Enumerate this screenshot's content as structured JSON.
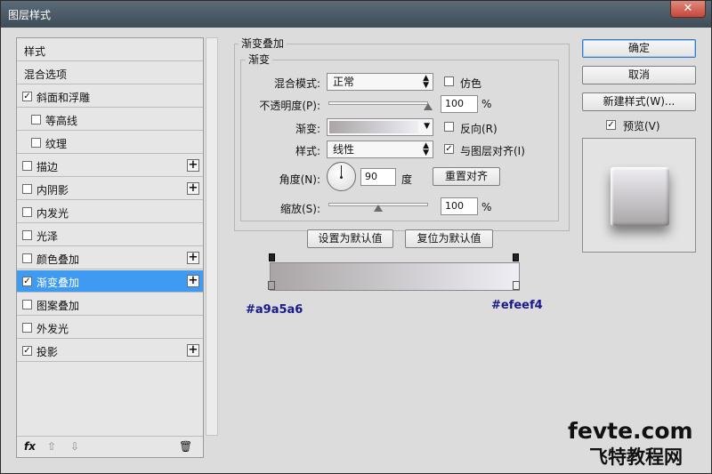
{
  "window": {
    "title": "图层样式",
    "close_label": "✕"
  },
  "left": {
    "items": [
      {
        "label": "样式",
        "checkbox": false,
        "checked": false,
        "plus": false,
        "indent": false,
        "selected": false
      },
      {
        "label": "混合选项",
        "checkbox": false,
        "checked": false,
        "plus": false,
        "indent": false,
        "selected": false
      },
      {
        "label": "斜面和浮雕",
        "checkbox": true,
        "checked": true,
        "plus": false,
        "indent": false,
        "selected": false
      },
      {
        "label": "等高线",
        "checkbox": true,
        "checked": false,
        "plus": false,
        "indent": true,
        "selected": false
      },
      {
        "label": "纹理",
        "checkbox": true,
        "checked": false,
        "plus": false,
        "indent": true,
        "selected": false
      },
      {
        "label": "描边",
        "checkbox": true,
        "checked": false,
        "plus": true,
        "indent": false,
        "selected": false
      },
      {
        "label": "内阴影",
        "checkbox": true,
        "checked": false,
        "plus": true,
        "indent": false,
        "selected": false
      },
      {
        "label": "内发光",
        "checkbox": true,
        "checked": false,
        "plus": false,
        "indent": false,
        "selected": false
      },
      {
        "label": "光泽",
        "checkbox": true,
        "checked": false,
        "plus": false,
        "indent": false,
        "selected": false
      },
      {
        "label": "颜色叠加",
        "checkbox": true,
        "checked": false,
        "plus": true,
        "indent": false,
        "selected": false
      },
      {
        "label": "渐变叠加",
        "checkbox": true,
        "checked": true,
        "plus": true,
        "indent": false,
        "selected": true
      },
      {
        "label": "图案叠加",
        "checkbox": true,
        "checked": false,
        "plus": false,
        "indent": false,
        "selected": false
      },
      {
        "label": "外发光",
        "checkbox": true,
        "checked": false,
        "plus": false,
        "indent": false,
        "selected": false
      },
      {
        "label": "投影",
        "checkbox": true,
        "checked": true,
        "plus": true,
        "indent": false,
        "selected": false
      }
    ],
    "footer": {
      "fx": "fx",
      "up": "⇧",
      "down": "⇩",
      "trash": "🗑"
    }
  },
  "main": {
    "group_title": "渐变叠加",
    "sub_title": "渐变",
    "blend_mode_label": "混合模式:",
    "blend_mode_value": "正常",
    "dither_label": "仿色",
    "opacity_label": "不透明度(P):",
    "opacity_value": "100",
    "opacity_unit": "%",
    "gradient_label": "渐变:",
    "reverse_label": "反向(R)",
    "style_label": "样式:",
    "style_value": "线性",
    "align_label": "与图层对齐(I)",
    "angle_label": "角度(N):",
    "angle_value": "90",
    "angle_unit": "度",
    "reset_align_label": "重置对齐",
    "scale_label": "缩放(S):",
    "scale_value": "100",
    "scale_unit": "%",
    "set_default_label": "设置为默认值",
    "reset_default_label": "复位为默认值",
    "left_stop_hex": "#a9a5a6",
    "right_stop_hex": "#efeef4",
    "opacity_level": 1.0,
    "scale_level": 0.5
  },
  "right": {
    "ok_label": "确定",
    "cancel_label": "取消",
    "new_style_label": "新建样式(W)...",
    "preview_label": "预览(V)"
  },
  "watermark": {
    "line1": "fevte.com",
    "line2": "飞特教程网"
  },
  "colors": {
    "selection": "#3f9bf1",
    "gradient_left": "#a9a5a6",
    "gradient_right": "#efeef4",
    "hex_text": "#1a1a8a"
  }
}
